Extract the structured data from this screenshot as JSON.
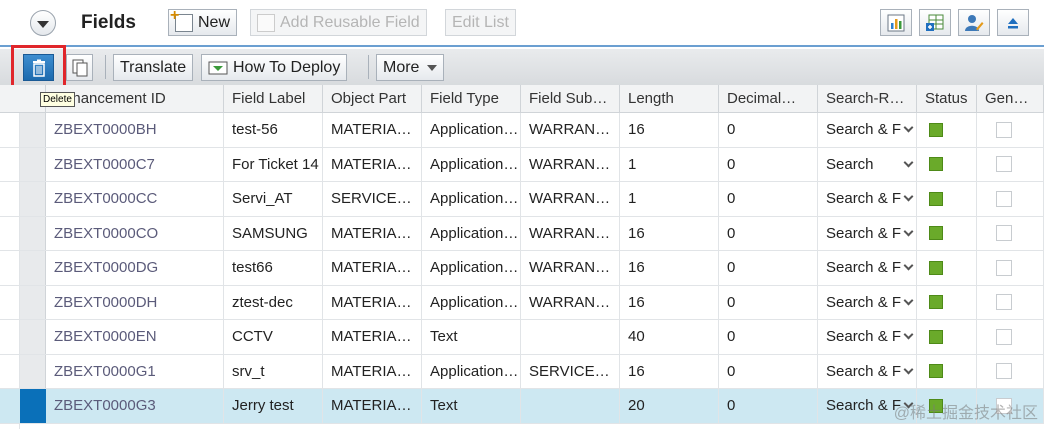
{
  "header": {
    "title": "Fields",
    "buttons": {
      "new": "New",
      "add_reusable": "Add Reusable Field",
      "edit_list": "Edit List"
    },
    "right_icons": [
      "bar-chart-icon",
      "export-table-icon",
      "user-edit-icon",
      "eject-icon"
    ]
  },
  "toolbar": {
    "translate": "Translate",
    "how_to_deploy": "How To Deploy",
    "more": "More",
    "tooltip": "Delete"
  },
  "table": {
    "columns": [
      "Enhancement ID",
      "Field Label",
      "Object Part",
      "Field Type",
      "Field Sub…",
      "Length",
      "Decimal…",
      "Search-R…",
      "Status",
      "Gen…"
    ],
    "rows": [
      {
        "id": "ZBEXT0000BH",
        "label": "test-56",
        "object_part": "MATERIA…",
        "field_type": "Application…",
        "field_sub": "WARRAN…",
        "length": "16",
        "decimal": "0",
        "search": "Search & F",
        "selected": false
      },
      {
        "id": "ZBEXT0000C7",
        "label": "For Ticket 14",
        "object_part": "MATERIA…",
        "field_type": "Application…",
        "field_sub": "WARRAN…",
        "length": "1",
        "decimal": "0",
        "search": "Search",
        "selected": false
      },
      {
        "id": "ZBEXT0000CC",
        "label": "Servi_AT",
        "object_part": "SERVICE…",
        "field_type": "Application…",
        "field_sub": "WARRAN…",
        "length": "1",
        "decimal": "0",
        "search": "Search & F",
        "selected": false
      },
      {
        "id": "ZBEXT0000CO",
        "label": "SAMSUNG",
        "object_part": "MATERIA…",
        "field_type": "Application…",
        "field_sub": "WARRAN…",
        "length": "16",
        "decimal": "0",
        "search": "Search & F",
        "selected": false
      },
      {
        "id": "ZBEXT0000DG",
        "label": "test66",
        "object_part": "MATERIA…",
        "field_type": "Application…",
        "field_sub": "WARRAN…",
        "length": "16",
        "decimal": "0",
        "search": "Search & F",
        "selected": false
      },
      {
        "id": "ZBEXT0000DH",
        "label": "ztest-dec",
        "object_part": "MATERIA…",
        "field_type": "Application…",
        "field_sub": "WARRAN…",
        "length": "16",
        "decimal": "0",
        "search": "Search & F",
        "selected": false
      },
      {
        "id": "ZBEXT0000EN",
        "label": "CCTV",
        "object_part": "MATERIA…",
        "field_type": "Text",
        "field_sub": "",
        "length": "40",
        "decimal": "0",
        "search": "Search & F",
        "selected": false
      },
      {
        "id": "ZBEXT0000G1",
        "label": "srv_t",
        "object_part": "MATERIA…",
        "field_type": "Application…",
        "field_sub": "SERVICE…",
        "length": "16",
        "decimal": "0",
        "search": "Search & F",
        "selected": false
      },
      {
        "id": "ZBEXT0000G3",
        "label": "Jerry test",
        "object_part": "MATERIA…",
        "field_type": "Text",
        "field_sub": "",
        "length": "20",
        "decimal": "0",
        "search": "Search & F",
        "selected": true
      }
    ]
  },
  "watermark": "@稀土掘金技术社区",
  "colors": {
    "accent": "#0a70b9",
    "status_green": "#6aaa2a",
    "highlight_frame": "#e0262b",
    "selected_row": "#cde8f2"
  }
}
